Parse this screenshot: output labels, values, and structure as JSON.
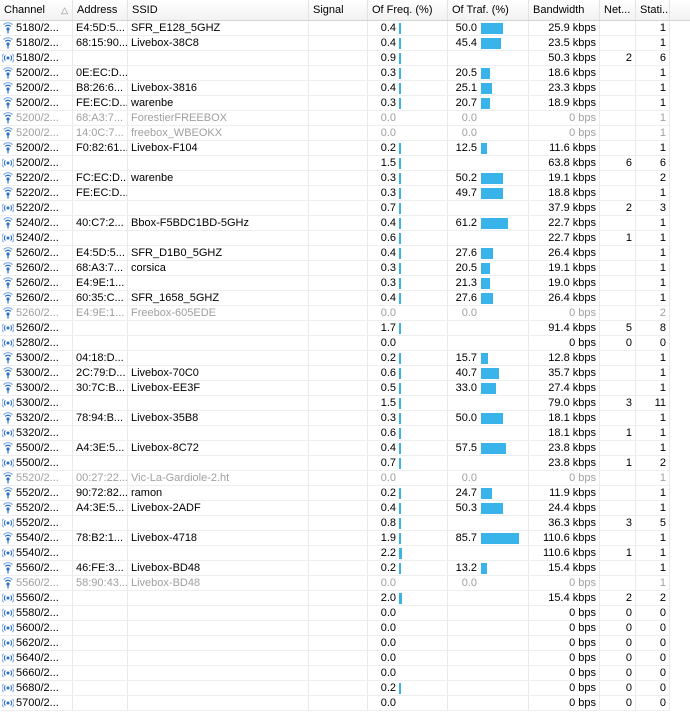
{
  "columns": {
    "channel": "Channel",
    "address": "Address",
    "ssid": "SSID",
    "signal": "Signal",
    "freq": "Of Freq. (%)",
    "traf": "Of Traf. (%)",
    "bandwidth": "Bandwidth",
    "networks": "Net...",
    "stations": "Stati..."
  },
  "sort_icon": "sort-ascending",
  "colors": {
    "bar": "#38b4ea",
    "dim_text": "#a0a0a0",
    "accent_icon": "#2a6fc9"
  },
  "rows": [
    {
      "icon": "single",
      "dim": false,
      "channel": "5180/2...",
      "address": "E4:5D:5...",
      "ssid": "SFR_E128_5GHZ",
      "freq": "0.4",
      "freq_pct": 0.4,
      "traf": "50.0",
      "traf_pct": 50.0,
      "bandwidth": "25.9 kbps",
      "networks": "",
      "stations": "1"
    },
    {
      "icon": "single",
      "dim": false,
      "channel": "5180/2...",
      "address": "68:15:90...",
      "ssid": "Livebox-38C8",
      "freq": "0.4",
      "freq_pct": 0.4,
      "traf": "45.4",
      "traf_pct": 45.4,
      "bandwidth": "23.5 kbps",
      "networks": "",
      "stations": "1"
    },
    {
      "icon": "group",
      "dim": false,
      "channel": "5180/2...",
      "address": "",
      "ssid": "",
      "freq": "0.9",
      "freq_pct": 0.9,
      "traf": "",
      "traf_pct": 0,
      "bandwidth": "50.3 kbps",
      "networks": "2",
      "stations": "6"
    },
    {
      "icon": "single",
      "dim": false,
      "channel": "5200/2...",
      "address": "0E:EC:D...",
      "ssid": "",
      "freq": "0.3",
      "freq_pct": 0.3,
      "traf": "20.5",
      "traf_pct": 20.5,
      "bandwidth": "18.6 kbps",
      "networks": "",
      "stations": "1"
    },
    {
      "icon": "single",
      "dim": false,
      "channel": "5200/2...",
      "address": "B8:26:6...",
      "ssid": "Livebox-3816",
      "freq": "0.4",
      "freq_pct": 0.4,
      "traf": "25.1",
      "traf_pct": 25.1,
      "bandwidth": "23.3 kbps",
      "networks": "",
      "stations": "1"
    },
    {
      "icon": "single",
      "dim": false,
      "channel": "5200/2...",
      "address": "FE:EC:D...",
      "ssid": "warenbe",
      "freq": "0.3",
      "freq_pct": 0.3,
      "traf": "20.7",
      "traf_pct": 20.7,
      "bandwidth": "18.9 kbps",
      "networks": "",
      "stations": "1"
    },
    {
      "icon": "single",
      "dim": true,
      "channel": "5200/2...",
      "address": "68:A3:7...",
      "ssid": "ForestierFREEBOX",
      "freq": "0.0",
      "freq_pct": 0,
      "traf": "0.0",
      "traf_pct": 0,
      "bandwidth": "0 bps",
      "networks": "",
      "stations": "1"
    },
    {
      "icon": "single",
      "dim": true,
      "channel": "5200/2...",
      "address": "14:0C:7...",
      "ssid": "freebox_WBEOKX",
      "freq": "0.0",
      "freq_pct": 0,
      "traf": "0.0",
      "traf_pct": 0,
      "bandwidth": "0 bps",
      "networks": "",
      "stations": "1"
    },
    {
      "icon": "single",
      "dim": false,
      "channel": "5200/2...",
      "address": "F0:82:61...",
      "ssid": "Livebox-F104",
      "freq": "0.2",
      "freq_pct": 0.2,
      "traf": "12.5",
      "traf_pct": 12.5,
      "bandwidth": "11.6 kbps",
      "networks": "",
      "stations": "1"
    },
    {
      "icon": "group",
      "dim": false,
      "channel": "5200/2...",
      "address": "",
      "ssid": "",
      "freq": "1.5",
      "freq_pct": 1.5,
      "traf": "",
      "traf_pct": 0,
      "bandwidth": "63.8 kbps",
      "networks": "6",
      "stations": "6"
    },
    {
      "icon": "single",
      "dim": false,
      "channel": "5220/2...",
      "address": "FC:EC:D...",
      "ssid": "warenbe",
      "freq": "0.3",
      "freq_pct": 0.3,
      "traf": "50.2",
      "traf_pct": 50.2,
      "bandwidth": "19.1 kbps",
      "networks": "",
      "stations": "2"
    },
    {
      "icon": "single",
      "dim": false,
      "channel": "5220/2...",
      "address": "FE:EC:D...",
      "ssid": "",
      "freq": "0.3",
      "freq_pct": 0.3,
      "traf": "49.7",
      "traf_pct": 49.7,
      "bandwidth": "18.8 kbps",
      "networks": "",
      "stations": "1"
    },
    {
      "icon": "group",
      "dim": false,
      "channel": "5220/2...",
      "address": "",
      "ssid": "",
      "freq": "0.7",
      "freq_pct": 0.7,
      "traf": "",
      "traf_pct": 0,
      "bandwidth": "37.9 kbps",
      "networks": "2",
      "stations": "3"
    },
    {
      "icon": "single",
      "dim": false,
      "channel": "5240/2...",
      "address": "40:C7:2...",
      "ssid": "Bbox-F5BDC1BD-5GHz",
      "freq": "0.4",
      "freq_pct": 0.4,
      "traf": "61.2",
      "traf_pct": 61.2,
      "bandwidth": "22.7 kbps",
      "networks": "",
      "stations": "1"
    },
    {
      "icon": "group",
      "dim": false,
      "channel": "5240/2...",
      "address": "",
      "ssid": "",
      "freq": "0.6",
      "freq_pct": 0.6,
      "traf": "",
      "traf_pct": 0,
      "bandwidth": "22.7 kbps",
      "networks": "1",
      "stations": "1"
    },
    {
      "icon": "single",
      "dim": false,
      "channel": "5260/2...",
      "address": "E4:5D:5...",
      "ssid": "SFR_D1B0_5GHZ",
      "freq": "0.4",
      "freq_pct": 0.4,
      "traf": "27.6",
      "traf_pct": 27.6,
      "bandwidth": "26.4 kbps",
      "networks": "",
      "stations": "1"
    },
    {
      "icon": "single",
      "dim": false,
      "channel": "5260/2...",
      "address": "68:A3:7...",
      "ssid": "corsica",
      "freq": "0.3",
      "freq_pct": 0.3,
      "traf": "20.5",
      "traf_pct": 20.5,
      "bandwidth": "19.1 kbps",
      "networks": "",
      "stations": "1"
    },
    {
      "icon": "single",
      "dim": false,
      "channel": "5260/2...",
      "address": "E4:9E:1...",
      "ssid": "",
      "freq": "0.3",
      "freq_pct": 0.3,
      "traf": "21.3",
      "traf_pct": 21.3,
      "bandwidth": "19.0 kbps",
      "networks": "",
      "stations": "1"
    },
    {
      "icon": "single",
      "dim": false,
      "channel": "5260/2...",
      "address": "60:35:C...",
      "ssid": "SFR_1658_5GHZ",
      "freq": "0.4",
      "freq_pct": 0.4,
      "traf": "27.6",
      "traf_pct": 27.6,
      "bandwidth": "26.4 kbps",
      "networks": "",
      "stations": "1"
    },
    {
      "icon": "single",
      "dim": true,
      "channel": "5260/2...",
      "address": "E4:9E:1...",
      "ssid": "Freebox-605EDE",
      "freq": "0.0",
      "freq_pct": 0,
      "traf": "0.0",
      "traf_pct": 0,
      "bandwidth": "0 bps",
      "networks": "",
      "stations": "2"
    },
    {
      "icon": "group",
      "dim": false,
      "channel": "5260/2...",
      "address": "",
      "ssid": "",
      "freq": "1.7",
      "freq_pct": 1.7,
      "traf": "",
      "traf_pct": 0,
      "bandwidth": "91.4 kbps",
      "networks": "5",
      "stations": "8"
    },
    {
      "icon": "group",
      "dim": false,
      "channel": "5280/2...",
      "address": "",
      "ssid": "",
      "freq": "0.0",
      "freq_pct": 0,
      "traf": "",
      "traf_pct": 0,
      "bandwidth": "0 bps",
      "networks": "0",
      "stations": "0"
    },
    {
      "icon": "single",
      "dim": false,
      "channel": "5300/2...",
      "address": "04:18:D...",
      "ssid": "",
      "freq": "0.2",
      "freq_pct": 0.2,
      "traf": "15.7",
      "traf_pct": 15.7,
      "bandwidth": "12.8 kbps",
      "networks": "",
      "stations": "1"
    },
    {
      "icon": "single",
      "dim": false,
      "channel": "5300/2...",
      "address": "2C:79:D...",
      "ssid": "Livebox-70C0",
      "freq": "0.6",
      "freq_pct": 0.6,
      "traf": "40.7",
      "traf_pct": 40.7,
      "bandwidth": "35.7 kbps",
      "networks": "",
      "stations": "1"
    },
    {
      "icon": "single",
      "dim": false,
      "channel": "5300/2...",
      "address": "30:7C:B...",
      "ssid": "Livebox-EE3F",
      "freq": "0.5",
      "freq_pct": 0.5,
      "traf": "33.0",
      "traf_pct": 33.0,
      "bandwidth": "27.4 kbps",
      "networks": "",
      "stations": "1"
    },
    {
      "icon": "group",
      "dim": false,
      "channel": "5300/2...",
      "address": "",
      "ssid": "",
      "freq": "1.5",
      "freq_pct": 1.5,
      "traf": "",
      "traf_pct": 0,
      "bandwidth": "79.0 kbps",
      "networks": "3",
      "stations": "11"
    },
    {
      "icon": "single",
      "dim": false,
      "channel": "5320/2...",
      "address": "78:94:B...",
      "ssid": "Livebox-35B8",
      "freq": "0.3",
      "freq_pct": 0.3,
      "traf": "50.0",
      "traf_pct": 50.0,
      "bandwidth": "18.1 kbps",
      "networks": "",
      "stations": "1"
    },
    {
      "icon": "group",
      "dim": false,
      "channel": "5320/2...",
      "address": "",
      "ssid": "",
      "freq": "0.6",
      "freq_pct": 0.6,
      "traf": "",
      "traf_pct": 0,
      "bandwidth": "18.1 kbps",
      "networks": "1",
      "stations": "1"
    },
    {
      "icon": "single",
      "dim": false,
      "channel": "5500/2...",
      "address": "A4:3E:5...",
      "ssid": "Livebox-8C72",
      "freq": "0.4",
      "freq_pct": 0.4,
      "traf": "57.5",
      "traf_pct": 57.5,
      "bandwidth": "23.8 kbps",
      "networks": "",
      "stations": "1"
    },
    {
      "icon": "group",
      "dim": false,
      "channel": "5500/2...",
      "address": "",
      "ssid": "",
      "freq": "0.7",
      "freq_pct": 0.7,
      "traf": "",
      "traf_pct": 0,
      "bandwidth": "23.8 kbps",
      "networks": "1",
      "stations": "2"
    },
    {
      "icon": "single",
      "dim": true,
      "channel": "5520/2...",
      "address": "00:27:22...",
      "ssid": "Vic-La-Gardiole-2.ht",
      "freq": "0.0",
      "freq_pct": 0,
      "traf": "0.0",
      "traf_pct": 0,
      "bandwidth": "0 bps",
      "networks": "",
      "stations": "1"
    },
    {
      "icon": "single",
      "dim": false,
      "channel": "5520/2...",
      "address": "90:72:82...",
      "ssid": "ramon",
      "freq": "0.2",
      "freq_pct": 0.2,
      "traf": "24.7",
      "traf_pct": 24.7,
      "bandwidth": "11.9 kbps",
      "networks": "",
      "stations": "1"
    },
    {
      "icon": "single",
      "dim": false,
      "channel": "5520/2...",
      "address": "A4:3E:5...",
      "ssid": "Livebox-2ADF",
      "freq": "0.4",
      "freq_pct": 0.4,
      "traf": "50.3",
      "traf_pct": 50.3,
      "bandwidth": "24.4 kbps",
      "networks": "",
      "stations": "1"
    },
    {
      "icon": "group",
      "dim": false,
      "channel": "5520/2...",
      "address": "",
      "ssid": "",
      "freq": "0.8",
      "freq_pct": 0.8,
      "traf": "",
      "traf_pct": 0,
      "bandwidth": "36.3 kbps",
      "networks": "3",
      "stations": "5"
    },
    {
      "icon": "single",
      "dim": false,
      "channel": "5540/2...",
      "address": "78:B2:1...",
      "ssid": "Livebox-4718",
      "freq": "1.9",
      "freq_pct": 1.9,
      "traf": "85.7",
      "traf_pct": 85.7,
      "bandwidth": "110.6 kbps",
      "networks": "",
      "stations": "1"
    },
    {
      "icon": "group",
      "dim": false,
      "channel": "5540/2...",
      "address": "",
      "ssid": "",
      "freq": "2.2",
      "freq_pct": 2.2,
      "traf": "",
      "traf_pct": 0,
      "bandwidth": "110.6 kbps",
      "networks": "1",
      "stations": "1"
    },
    {
      "icon": "single",
      "dim": false,
      "channel": "5560/2...",
      "address": "46:FE:3...",
      "ssid": "Livebox-BD48",
      "freq": "0.2",
      "freq_pct": 0.2,
      "traf": "13.2",
      "traf_pct": 13.2,
      "bandwidth": "15.4 kbps",
      "networks": "",
      "stations": "1"
    },
    {
      "icon": "single",
      "dim": true,
      "channel": "5560/2...",
      "address": "58:90:43...",
      "ssid": "Livebox-BD48",
      "freq": "0.0",
      "freq_pct": 0,
      "traf": "0.0",
      "traf_pct": 0,
      "bandwidth": "0 bps",
      "networks": "",
      "stations": "1"
    },
    {
      "icon": "group",
      "dim": false,
      "channel": "5560/2...",
      "address": "",
      "ssid": "",
      "freq": "2.0",
      "freq_pct": 2.0,
      "traf": "",
      "traf_pct": 0,
      "bandwidth": "15.4 kbps",
      "networks": "2",
      "stations": "2"
    },
    {
      "icon": "group",
      "dim": false,
      "channel": "5580/2...",
      "address": "",
      "ssid": "",
      "freq": "0.0",
      "freq_pct": 0,
      "traf": "",
      "traf_pct": 0,
      "bandwidth": "0 bps",
      "networks": "0",
      "stations": "0"
    },
    {
      "icon": "group",
      "dim": false,
      "channel": "5600/2...",
      "address": "",
      "ssid": "",
      "freq": "0.0",
      "freq_pct": 0,
      "traf": "",
      "traf_pct": 0,
      "bandwidth": "0 bps",
      "networks": "0",
      "stations": "0"
    },
    {
      "icon": "group",
      "dim": false,
      "channel": "5620/2...",
      "address": "",
      "ssid": "",
      "freq": "0.0",
      "freq_pct": 0,
      "traf": "",
      "traf_pct": 0,
      "bandwidth": "0 bps",
      "networks": "0",
      "stations": "0"
    },
    {
      "icon": "group",
      "dim": false,
      "channel": "5640/2...",
      "address": "",
      "ssid": "",
      "freq": "0.0",
      "freq_pct": 0,
      "traf": "",
      "traf_pct": 0,
      "bandwidth": "0 bps",
      "networks": "0",
      "stations": "0"
    },
    {
      "icon": "group",
      "dim": false,
      "channel": "5660/2...",
      "address": "",
      "ssid": "",
      "freq": "0.0",
      "freq_pct": 0,
      "traf": "",
      "traf_pct": 0,
      "bandwidth": "0 bps",
      "networks": "0",
      "stations": "0"
    },
    {
      "icon": "group",
      "dim": false,
      "channel": "5680/2...",
      "address": "",
      "ssid": "",
      "freq": "0.2",
      "freq_pct": 0.2,
      "traf": "",
      "traf_pct": 0,
      "bandwidth": "0 bps",
      "networks": "0",
      "stations": "0"
    },
    {
      "icon": "group",
      "dim": false,
      "channel": "5700/2...",
      "address": "",
      "ssid": "",
      "freq": "0.0",
      "freq_pct": 0,
      "traf": "",
      "traf_pct": 0,
      "bandwidth": "0 bps",
      "networks": "0",
      "stations": "0"
    }
  ]
}
